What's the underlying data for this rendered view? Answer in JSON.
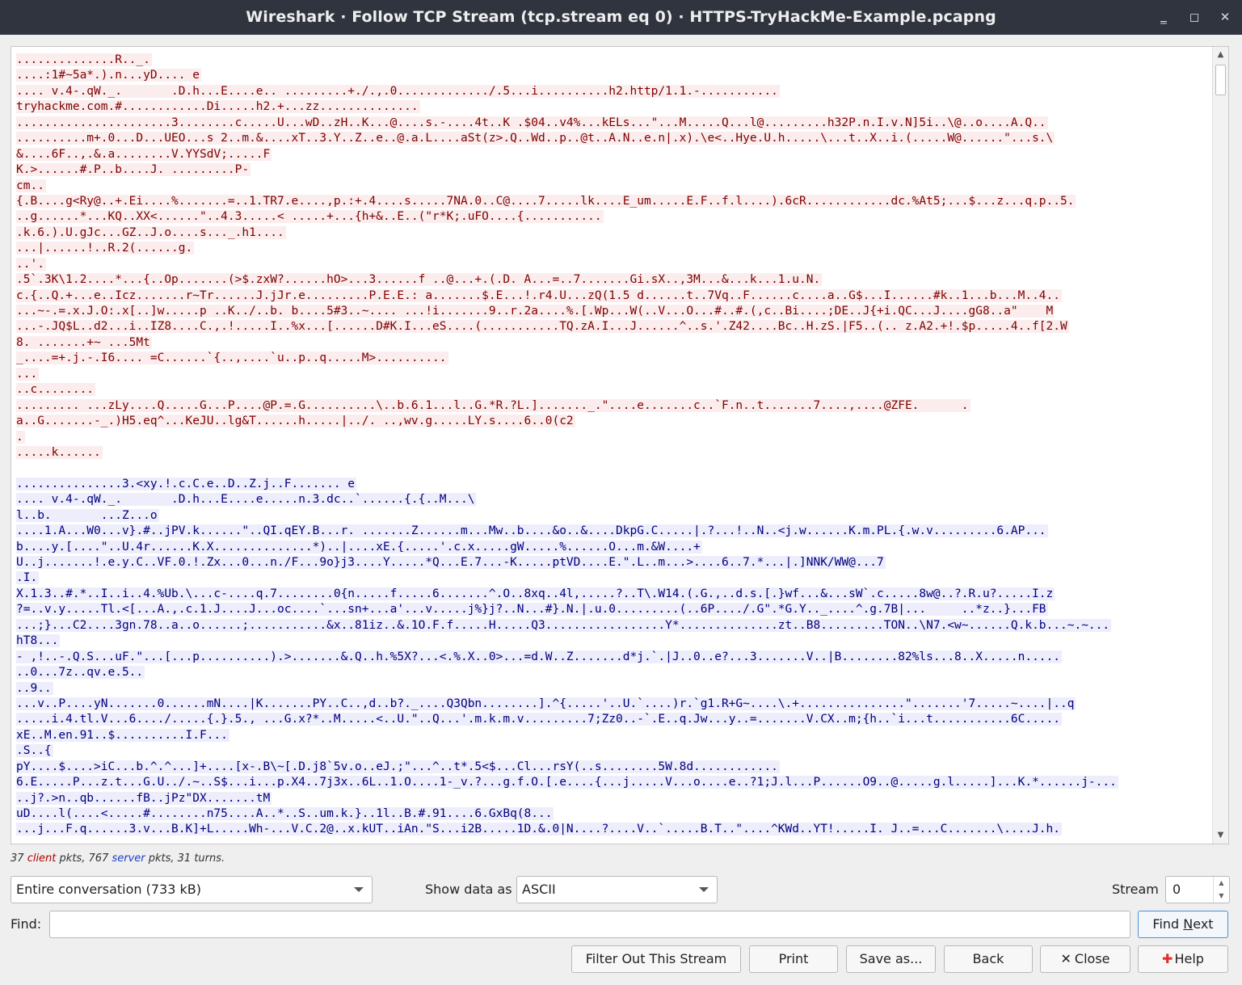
{
  "window": {
    "title": "Wireshark · Follow TCP Stream (tcp.stream eq 0) · HTTPS-TryHackMe-Example.pcapng",
    "minimize_glyph": "‗",
    "maximize_glyph": "◻",
    "close_glyph": "✕"
  },
  "colors": {
    "client_bg": "#fbeded",
    "client_fg": "#7f0000",
    "server_bg": "#ededfb",
    "server_fg": "#00007f"
  },
  "stream": {
    "client_lines": [
      "..............R.._.",
      "....:1#~5a*.).n...yD.... e",
      ".... v.4-.qW._.       .D.h...E....e.. .........+./.,.0............./.5...i..........h2.http/1.1.-...........",
      "tryhackme.com.#............Di.....h2.+...zz..............",
      "......................3........c.....U...wD..zH..K...@....s.-....4t..K .$04..v4%...kELs...\"...M.....Q...l@.........h32P.n.I.v.N]5i..\\@..o....A.Q..",
      "..........m+.0...D...UEO...s 2..m.&....xT..3.Y..Z..e..@.a.L....aSt(z>.Q..Wd..p..@t..A.N..e.n|.x).\\e<..Hye.U.h.....\\...t..X..i.(.....W@......\"...s.\\",
      "&....6F..,.&.a........V.YYSdV;.....F",
      "K.>......#.P..b....J. .........P-",
      "cm..",
      "{.B....g<Ry@..+.Ei....%.......=..1.TR7.e....,p.:+.4....s.....7NA.0..C@....7.....lk....E_um.....E.F..f.l....).6cR............dc.%At5;...$...z...q.p..5.",
      "..g......*...KQ..XX<......\"..4.3.....< .....+...{h+&..E..(\"r*K;.uFO....{...........",
      ".k.6.).U.gJc...GZ..J.o....s..._.h1....",
      "...|......!..R.2(......g.",
      "..'.",
      ".5`.3K\\1.2....*...{..Op.......(>$.zxW?......hO>...3......f ..@...+.(.D. A...=..7.......Gi.sX..,3M...&...k...1.u.N.",
      "c.{..Q.+...e..Icz.......r~Tr......J.jJr.e.........P.E.E.: a.......$.E...!.r4.U...zQ(1.5 d......t..7Vq..F......c....a..G$...I......#k..1...b...M..4..",
      "...~-.=.x.J.O:.x[..]w.....p ..K../..b. b....5#3..~.... ...!i.......9..r.2a....%.[.Wp...W(..V...O...#..#.(,c..Bi....;DE..J{+i.QC...J....gG8..a\"    M",
      "...-.JQ$L..d2...i..IZ8....C.,.!.....I..%x...[......D#K.I...eS....(...........TQ.zA.I...J......^..s.'.Z42....Bc..H.zS.|F5..(.. z.A2.+!.$p.....4..f[2.W",
      "8. .......+~ ...5Mt",
      "_....=+.j.-.I6.... =C......`{..,....`u..p..q.....M>..........",
      "...",
      "..c........",
      "......... ...zLy....Q.....G...P....@P.=.G..........\\..b.6.1...l..G.*R.?L.]......._.\"....e.......c..`F.n..t.......7....,....@ZFE.      .",
      "a..G.......-_.)H5.eq^...KeJU..lg&T......h.....|../. ..,wv.g.....LY.s....6..0(c2",
      ".",
      ".....k......"
    ],
    "server_lines": [
      "...............3.<xy.!.c.C.e..D..Z.j..F....... e",
      ".... v.4-.qW._.       .D.h...E....e.....n.3.dc..`......{.{..M...\\",
      "l..b.       ...Z...o",
      "....1.A...W0...v}.#..jPV.k......\"..QI.qEY.B...r. .......Z......m...Mw..b....&o..&....DkpG.C.....|.?...!..N..<j.w......K.m.PL.{.w.v.........6.AP...",
      "b....y.[....\"..U.4r......K.X..............*)..|....xE.{.....'.c.x.....gW.....%......O...m.&W....+",
      "U..j.......!.e.y.C..VF.0.!.Zx...0...n./F...9o}j3....Y.....*Q...E.7...-K.....ptVD....E.\".L..m...>....6..7.*...|.]NNK/WW@...7",
      ".I.",
      "X.1.3..#.*..I..i..4.%Ub.\\...c-....q.7........0{n.....f.....6.......^.O..8xq..4l,.....?..T\\.W14.(.G.,..d.s.[.}wf...&...sW`.c.....8w@..?.R.u?.....I.z",
      "?=..v.y.....Tl.<[...A.,.c.1.J....J...oc....`...sn+...a'...v.....j%}j?..N...#}.N.|.u.0.........(..6P..../.G\".*G.Y.._....^.g.7B|...     ..*z..}...FB",
      "...;}...C2....3gn.78..a..o......;...........&x..81iz..&.1O.F.f.....H.....Q3.................Y*..............zt..B8.........TON..\\N7.<w~......Q.k.b...~.~...",
      "hT8...",
      "- ,!..-.Q.S...uF.\"...[...p..........).>.......&.Q..h.%5X?...<.%.X..0>...=d.W..Z.......d*j.`.|J..0..e?...3.......V..|B........82%ls...8..X.....n.....",
      "..0...7z..qv.e.5..",
      "..9..",
      "...v..P....yN.......0......mN....|K.......PY..C..,d..b?._....Q3Qbn........].^{.....'..U.`....)r.`g1.R+G~....\\.+...............\".......'7.....~....|..q",
      ".....i.4.tl.V...6..../.....{.}.5., ...G.x?*..M.....<..U.\"..Q...'.m.k.m.v.........7;Zz0..-`.E..q.Jw...y..=.......V.CX..m;{h..`i...t...........6C.....",
      "xE..M.en.91..$..........I.F...",
      ".S..{",
      "pY....$....>iC...b.^.^...]+....[x-.B\\~[.D.j8`5v.o..eJ.;\"...^..t*.5<$...Cl...rsY(..s........5W.8d............",
      "6.E.....P...z.t...G.U../.~..S$...i...p.X4..7j3x..6L..1.O....1-_v.?...g.f.O.[.e....{...j.....V...o....e..?1;J.l...P......O9..@.....g.l.....]...K.*......j-...",
      "..j?.>n..qb......fB..jPz\"DX.......tM",
      "uD....l(....<.....#........n75....A..*..S..um.k.}..1l..B.#.91....6.GxBq(8...",
      "...j...F.q......3.v...B.K]+L.....Wh-...V.C.2@..x.kUT..iAn.\"S...i2B.....1D.&.0|N....?....V..`.....B.T..\"....^KWd..YT!.....I. J..=...C.......\\....J.h."
    ]
  },
  "stats": {
    "client_count": "37",
    "client_word": "client",
    "pkts_sep": "pkts,",
    "server_count": "767",
    "server_word": "server",
    "tail": "pkts, 31 turns."
  },
  "controls": {
    "conversation_select": "Entire conversation (733 kB)",
    "show_data_label": "Show data as",
    "show_data_value": "ASCII",
    "stream_label": "Stream",
    "stream_value": "0",
    "find_label": "Find:",
    "find_value": "",
    "find_next_prefix": "Find ",
    "find_next_underlined": "N",
    "find_next_suffix": "ext"
  },
  "buttons": {
    "filter_out": "Filter Out This Stream",
    "print": "Print",
    "save_as": "Save as...",
    "back": "Back",
    "close": "Close",
    "help": "Help"
  }
}
